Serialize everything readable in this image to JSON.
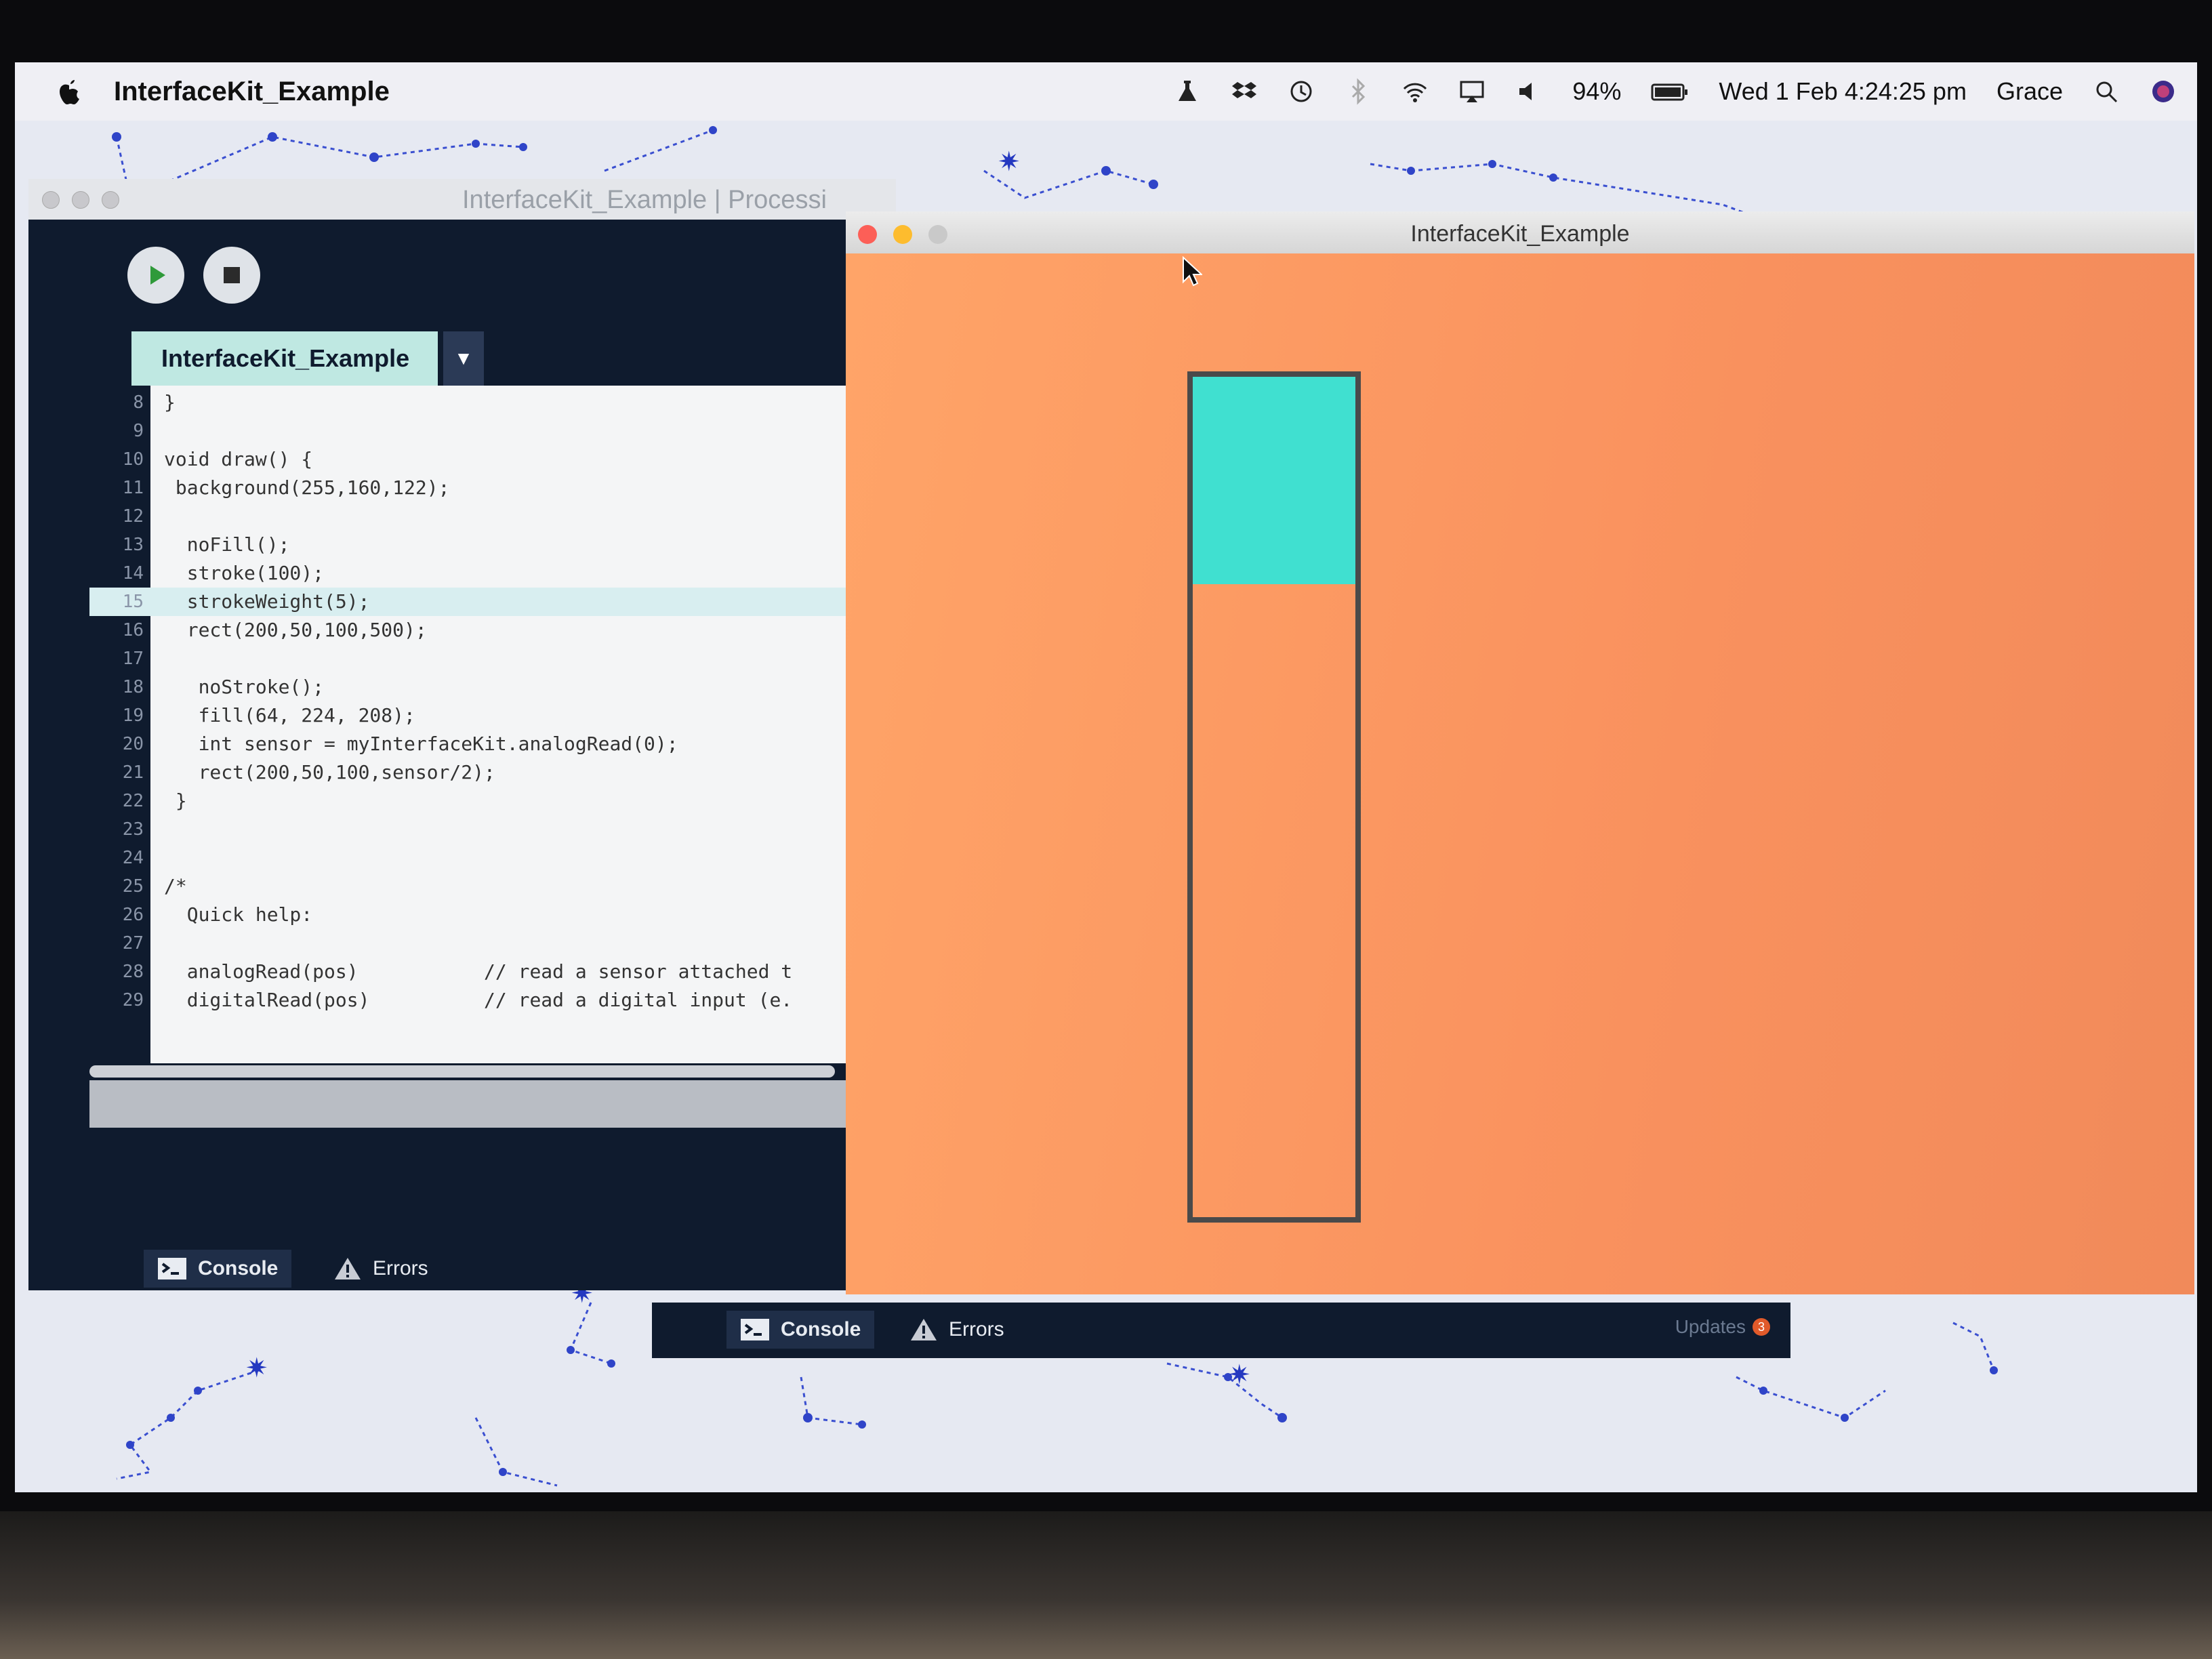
{
  "menubar": {
    "app_name": "InterfaceKit_Example",
    "battery": "94%",
    "datetime": "Wed 1 Feb  4:24:25 pm",
    "user": "Grace"
  },
  "ide": {
    "window_title": "InterfaceKit_Example | Processi",
    "tab_label": "InterfaceKit_Example",
    "highlighted_line": 15,
    "code_lines": [
      {
        "n": "8",
        "text": "}"
      },
      {
        "n": "9",
        "text": ""
      },
      {
        "n": "10",
        "text": "void draw() {"
      },
      {
        "n": "11",
        "text": " background(255,160,122);"
      },
      {
        "n": "12",
        "text": ""
      },
      {
        "n": "13",
        "text": "  noFill();"
      },
      {
        "n": "14",
        "text": "  stroke(100);"
      },
      {
        "n": "15",
        "text": "  strokeWeight(5);"
      },
      {
        "n": "16",
        "text": "  rect(200,50,100,500);"
      },
      {
        "n": "17",
        "text": ""
      },
      {
        "n": "18",
        "text": "   noStroke();"
      },
      {
        "n": "19",
        "text": "   fill(64, 224, 208);"
      },
      {
        "n": "20",
        "text": "   int sensor = myInterfaceKit.analogRead(0);"
      },
      {
        "n": "21",
        "text": "   rect(200,50,100,sensor/2);"
      },
      {
        "n": "22",
        "text": " }"
      },
      {
        "n": "23",
        "text": ""
      },
      {
        "n": "24",
        "text": ""
      },
      {
        "n": "25",
        "text": "/*"
      },
      {
        "n": "26",
        "text": "  Quick help:"
      },
      {
        "n": "27",
        "text": ""
      },
      {
        "n": "28",
        "text": "  analogRead(pos)           // read a sensor attached t"
      },
      {
        "n": "29",
        "text": "  digitalRead(pos)          // read a digital input (e."
      }
    ],
    "console_tab": "Console",
    "errors_tab": "Errors"
  },
  "sketch": {
    "window_title": "InterfaceKit_Example",
    "background_color": "#ffa07a",
    "fill_color": "#40e0d0",
    "stroke_color": "#646464",
    "sensor_level_fraction": 0.25
  },
  "console2": {
    "console_tab": "Console",
    "errors_tab": "Errors",
    "updates_label": "Updates",
    "updates_count": "3"
  }
}
